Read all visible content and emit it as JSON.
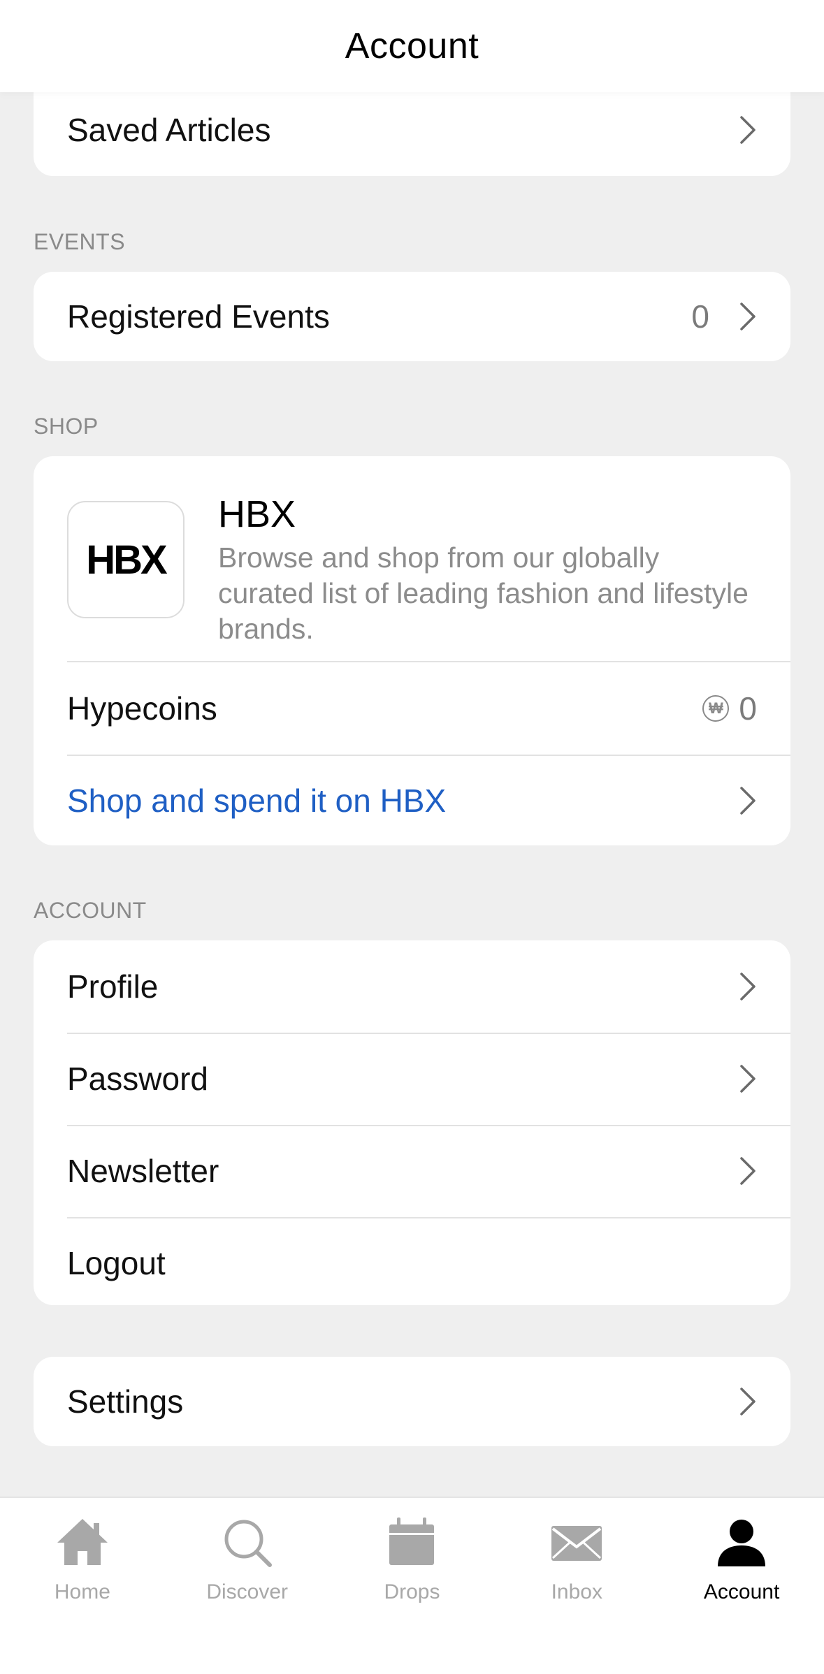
{
  "header": {
    "title": "Account"
  },
  "saved": {
    "label": "Saved Articles"
  },
  "events": {
    "section": "EVENTS",
    "registered_label": "Registered Events",
    "registered_count": "0"
  },
  "shop": {
    "section": "SHOP",
    "logo_text": "HBX",
    "name": "HBX",
    "description": "Browse and shop from our globally curated list of leading fashion and lifestyle brands.",
    "hypecoins_label": "Hypecoins",
    "coin_symbol": "₩",
    "hypecoins_value": "0",
    "link_label": "Shop and spend it on HBX"
  },
  "account": {
    "section": "ACCOUNT",
    "items": [
      {
        "label": "Profile"
      },
      {
        "label": "Password"
      },
      {
        "label": "Newsletter"
      },
      {
        "label": "Logout"
      }
    ]
  },
  "settings": {
    "label": "Settings"
  },
  "tabbar": {
    "tabs": [
      {
        "label": "Home",
        "icon": "home-icon"
      },
      {
        "label": "Discover",
        "icon": "search-icon"
      },
      {
        "label": "Drops",
        "icon": "calendar-icon"
      },
      {
        "label": "Inbox",
        "icon": "mail-icon"
      },
      {
        "label": "Account",
        "icon": "person-icon",
        "active": true
      }
    ]
  },
  "colors": {
    "background": "#efefef",
    "link": "#1f5fc4",
    "muted": "#8a8a8a",
    "tab_inactive": "#a8a8a8"
  }
}
